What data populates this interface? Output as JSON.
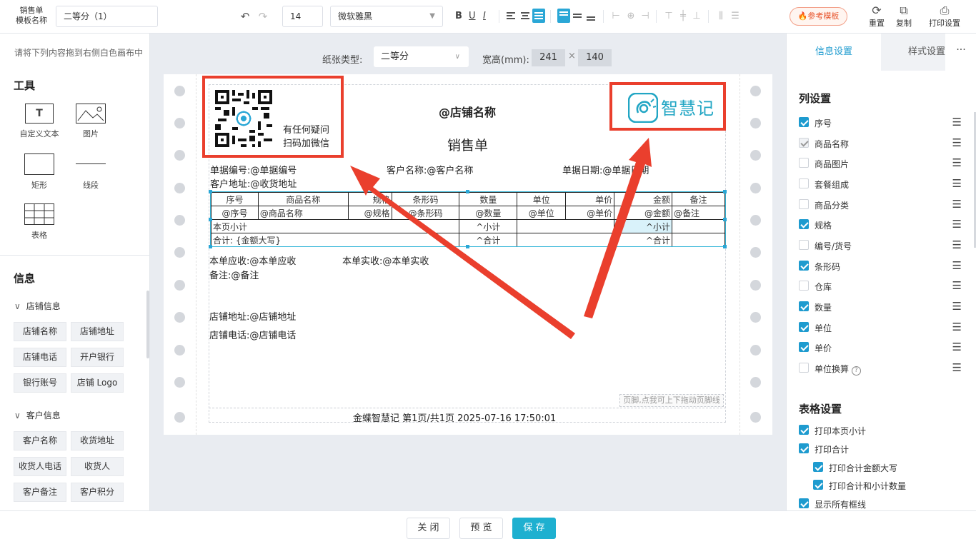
{
  "topbar": {
    "template_label": "销售单\n模板名称",
    "template_name": "二等分（1）",
    "font_size": "14",
    "font_family": "微软雅黑",
    "bold": "B",
    "underline": "U",
    "italic": "I",
    "ref_template": "参考模板",
    "reset": "重置",
    "copy": "复制",
    "print_settings": "打印设置"
  },
  "left": {
    "hint": "请将下列内容拖到右侧白色画布中",
    "tools_title": "工具",
    "tools": [
      "自定义文本",
      "图片",
      "矩形",
      "线段",
      "表格"
    ],
    "info_title": "信息",
    "groups": [
      {
        "name": "店铺信息",
        "items": [
          "店铺名称",
          "店铺地址",
          "店铺电话",
          "开户银行",
          "银行账号",
          "店铺 Logo"
        ]
      },
      {
        "name": "客户信息",
        "items": [
          "客户名称",
          "收货地址",
          "收货人电话",
          "收货人",
          "客户备注",
          "客户积分"
        ]
      }
    ]
  },
  "center": {
    "paper_type_label": "纸张类型:",
    "paper_type": "二等分",
    "size_label": "宽高(mm):",
    "width": "241",
    "times": "×",
    "height": "140"
  },
  "paper": {
    "qr_text1": "有任何疑问",
    "qr_text2": "扫码加微信",
    "shop_name": "@店铺名称",
    "doc_title": "销售单",
    "logo_text": "智慧记",
    "doc_no": "单据编号:@单据编号",
    "customer": "客户名称:@客户名称",
    "doc_date": "单据日期:@单据日期",
    "address": "客户地址:@收货地址",
    "table": {
      "headers": [
        "序号",
        "商品名称",
        "规格",
        "条形码",
        "数量",
        "单位",
        "单价",
        "金额",
        "备注"
      ],
      "row": [
        "@序号",
        "@商品名称",
        "@规格",
        "@条形码",
        "@数量",
        "@单位",
        "@单价",
        "@金额",
        "@备注"
      ],
      "subtotal_label": "本页小计",
      "subtotal_qty": "^小计",
      "subtotal_amount": "^小计",
      "total_label": "合计: {金额大写}",
      "total_qty": "^合计",
      "total_amount": "^合计"
    },
    "receivable": "本单应收:@本单应收",
    "received": "本单实收:@本单实收",
    "remark": "备注:@备注",
    "shop_address": "店铺地址:@店铺地址",
    "shop_phone": "店铺电话:@店铺电话",
    "footer_hint": "页脚,点我可上下拖动页脚线",
    "footer": "金蝶智慧记  第1页/共1页  2025-07-16 17:50:01"
  },
  "right": {
    "tabs": [
      "信息设置",
      "样式设置"
    ],
    "more": "···",
    "col_title": "列设置",
    "columns": [
      {
        "label": "序号",
        "state": "checked"
      },
      {
        "label": "商品名称",
        "state": "disabled"
      },
      {
        "label": "商品图片",
        "state": "unchecked"
      },
      {
        "label": "套餐组成",
        "state": "unchecked"
      },
      {
        "label": "商品分类",
        "state": "unchecked"
      },
      {
        "label": "规格",
        "state": "checked"
      },
      {
        "label": "编号/货号",
        "state": "unchecked"
      },
      {
        "label": "条形码",
        "state": "checked"
      },
      {
        "label": "仓库",
        "state": "unchecked"
      },
      {
        "label": "数量",
        "state": "checked"
      },
      {
        "label": "单位",
        "state": "checked"
      },
      {
        "label": "单价",
        "state": "checked"
      },
      {
        "label": "单位换算",
        "state": "unchecked"
      }
    ],
    "table_title": "表格设置",
    "table_settings": [
      {
        "label": "打印本页小计",
        "indent": false
      },
      {
        "label": "打印合计",
        "indent": false
      },
      {
        "label": "打印合计金额大写",
        "indent": true
      },
      {
        "label": "打印合计和小计数量",
        "indent": true
      },
      {
        "label": "显示所有框线",
        "indent": false
      }
    ]
  },
  "bottom": {
    "close": "关 闭",
    "preview": "预 览",
    "save": "保 存"
  },
  "colors": {
    "accent": "#1e9bcf",
    "annotation_red": "#ea3f2d",
    "save_button": "#1eb0d0"
  }
}
